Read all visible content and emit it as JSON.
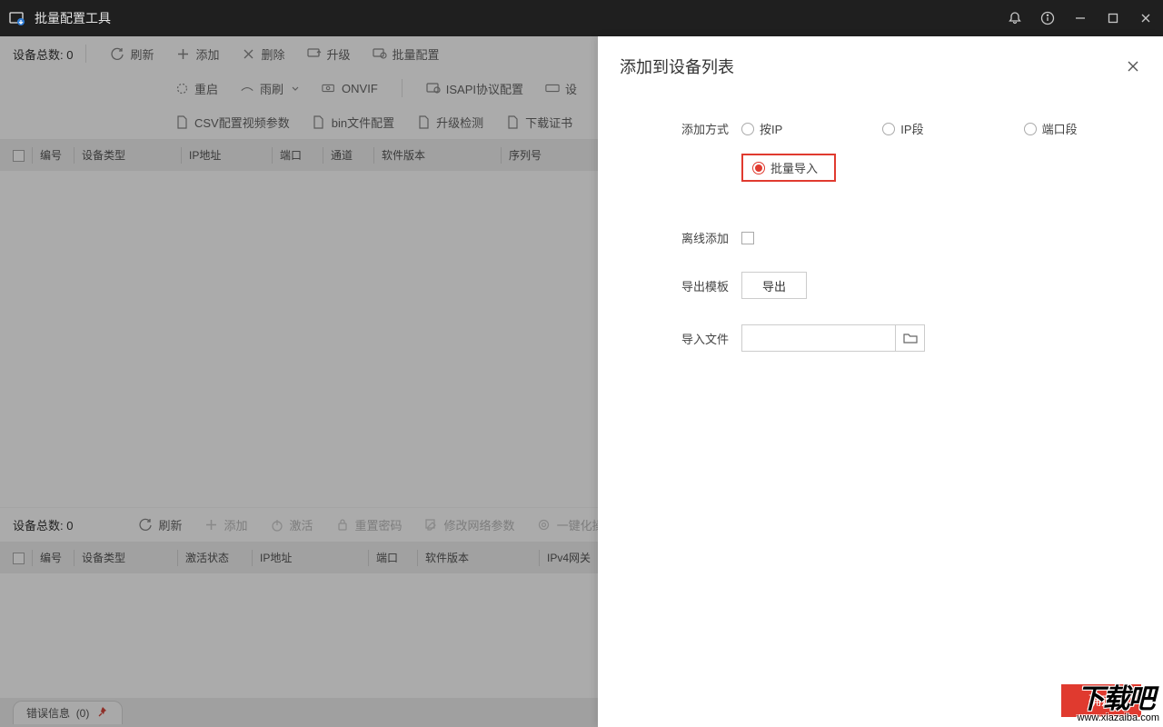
{
  "titlebar": {
    "title": "批量配置工具"
  },
  "upper": {
    "count_label": "设备总数:",
    "count_value": "0",
    "toolbar1": {
      "refresh": "刷新",
      "add": "添加",
      "delete": "删除",
      "upgrade": "升级",
      "batch_config": "批量配置"
    },
    "toolbar2": {
      "reboot": "重启",
      "wiper": "雨刷",
      "onvif": "ONVIF",
      "isapi": "ISAPI协议配置",
      "more": "设"
    },
    "toolbar3": {
      "csv": "CSV配置视频参数",
      "bin": "bin文件配置",
      "upgrade_check": "升级检测",
      "download_cert": "下载证书"
    },
    "columns": {
      "c1": "编号",
      "c2": "设备类型",
      "c3": "IP地址",
      "c4": "端口",
      "c5": "通道",
      "c6": "软件版本",
      "c7": "序列号"
    }
  },
  "lower": {
    "count_label": "设备总数:",
    "count_value": "0",
    "toolbar": {
      "refresh": "刷新",
      "add": "添加",
      "activate": "激活",
      "reset_pw": "重置密码",
      "modify_net": "修改网络参数",
      "onekey": "一键化操"
    },
    "columns": {
      "c1": "编号",
      "c2": "设备类型",
      "c3": "激活状态",
      "c4": "IP地址",
      "c5": "端口",
      "c6": "软件版本",
      "c7": "IPv4网关"
    }
  },
  "status": {
    "label": "错误信息",
    "count": "(0)"
  },
  "dialog": {
    "title": "添加到设备列表",
    "add_method_label": "添加方式",
    "radios": {
      "by_ip": "按IP",
      "ip_range": "IP段",
      "port_range": "端口段",
      "batch_import": "批量导入"
    },
    "offline_add": "离线添加",
    "export_template_label": "导出模板",
    "export_btn": "导出",
    "import_file_label": "导入文件",
    "import_value": "",
    "confirm": "确定"
  },
  "watermark": {
    "cn": "下载吧",
    "url": "www.xiazaiba.com"
  }
}
